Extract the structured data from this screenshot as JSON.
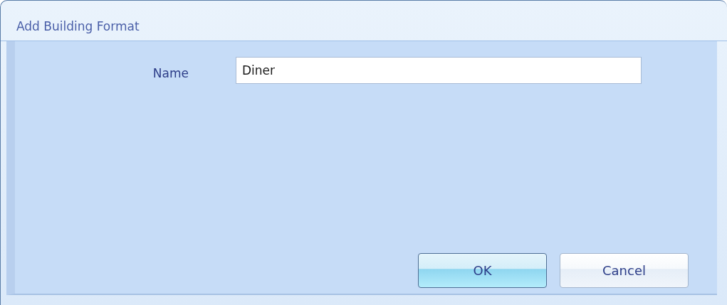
{
  "window": {
    "title": "Add Building Format"
  },
  "fields": [
    {
      "label": "Name",
      "value": "Diner"
    }
  ],
  "buttons": [
    {
      "label": "OK",
      "default": true
    },
    {
      "label": "Cancel",
      "default": false
    }
  ]
}
